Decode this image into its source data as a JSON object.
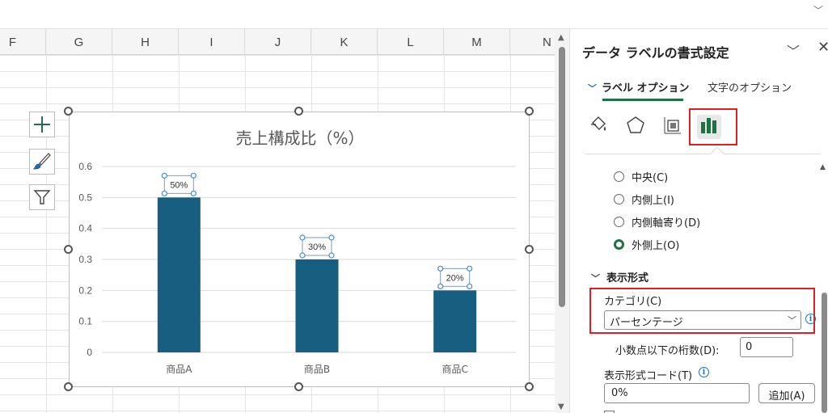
{
  "sheet": {
    "columns": [
      "F",
      "G",
      "H",
      "I",
      "J",
      "K",
      "L",
      "M",
      "N"
    ]
  },
  "chart_tools": {
    "add_element_icon": "plus-icon",
    "style_icon": "brush-icon",
    "filter_icon": "filter-icon"
  },
  "chart_data": {
    "type": "bar",
    "title": "売上構成比（%）",
    "categories": [
      "商品A",
      "商品B",
      "商品C"
    ],
    "values": [
      0.5,
      0.3,
      0.2
    ],
    "data_labels": [
      "50%",
      "30%",
      "20%"
    ],
    "y_ticks": [
      "0",
      "0.1",
      "0.2",
      "0.3",
      "0.4",
      "0.5",
      "0.6"
    ],
    "ylim": [
      0,
      0.6
    ],
    "grid": true,
    "bar_color": "#175e80"
  },
  "pane": {
    "title": "データ ラベルの書式設定",
    "tabs": {
      "label_options": "ラベル オプション",
      "text_options": "文字のオプション"
    },
    "icon_tabs": [
      "fill-icon",
      "pentagon-icon",
      "size-properties-icon",
      "bar-chart-icon"
    ],
    "label_position": {
      "options": [
        "中央(C)",
        "内側上(I)",
        "内側軸寄り(D)",
        "外側上(O)"
      ],
      "selected": "外側上(O)"
    },
    "number": {
      "section_title": "表示形式",
      "category_label": "カテゴリ(C)",
      "category_value": "パーセンテージ",
      "decimal_label": "小数点以下の桁数(D):",
      "decimal_value": "0",
      "format_code_label": "表示形式コード(T)",
      "format_code_value": "0%",
      "add_button": "追加(A)"
    },
    "accent_color": "#1e7145",
    "highlight_color": "#e02020"
  }
}
